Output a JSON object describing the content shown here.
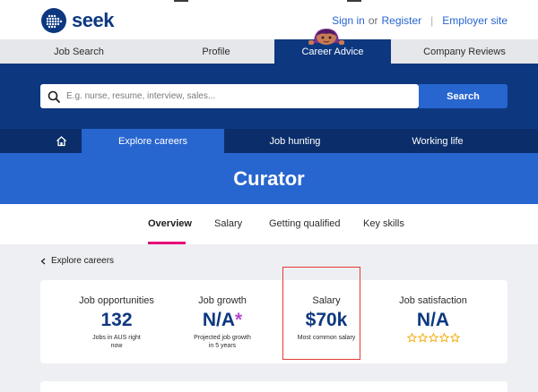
{
  "brand": {
    "name": "seek",
    "color": "#0d3880",
    "accent": "#2765cf",
    "pink": "#e60278"
  },
  "toplinks": {
    "signin": "Sign in",
    "or": "or",
    "register": "Register",
    "separator": "|",
    "employer": "Employer site"
  },
  "mainnav": [
    {
      "label": "Job Search",
      "active": false
    },
    {
      "label": "Profile",
      "active": false
    },
    {
      "label": "Career Advice",
      "active": true
    },
    {
      "label": "Company Reviews",
      "active": false
    }
  ],
  "search": {
    "placeholder": "E.g. nurse, resume, interview, sales...",
    "button": "Search",
    "icon": "search-icon"
  },
  "subnav": {
    "home_icon": "home-icon",
    "items": [
      "Explore careers",
      "Job hunting",
      "Working life"
    ]
  },
  "hero": {
    "title": "Curator"
  },
  "pagetabs": [
    "Overview",
    "Salary",
    "Getting qualified",
    "Key skills"
  ],
  "breadcrumb": {
    "label": "Explore careers",
    "icon": "chevron-left-icon"
  },
  "stats": [
    {
      "label": "Job opportunities",
      "value": "132",
      "sub": "Jobs in AUS right now"
    },
    {
      "label": "Job growth",
      "value": "N/A",
      "asterisk": "*",
      "sub": "Projected job growth in 5 years"
    },
    {
      "label": "Salary",
      "value": "$70k",
      "sub": "Most common salary"
    },
    {
      "label": "Job satisfaction",
      "value": "N/A",
      "rating": 0,
      "rating_max": 5
    }
  ]
}
